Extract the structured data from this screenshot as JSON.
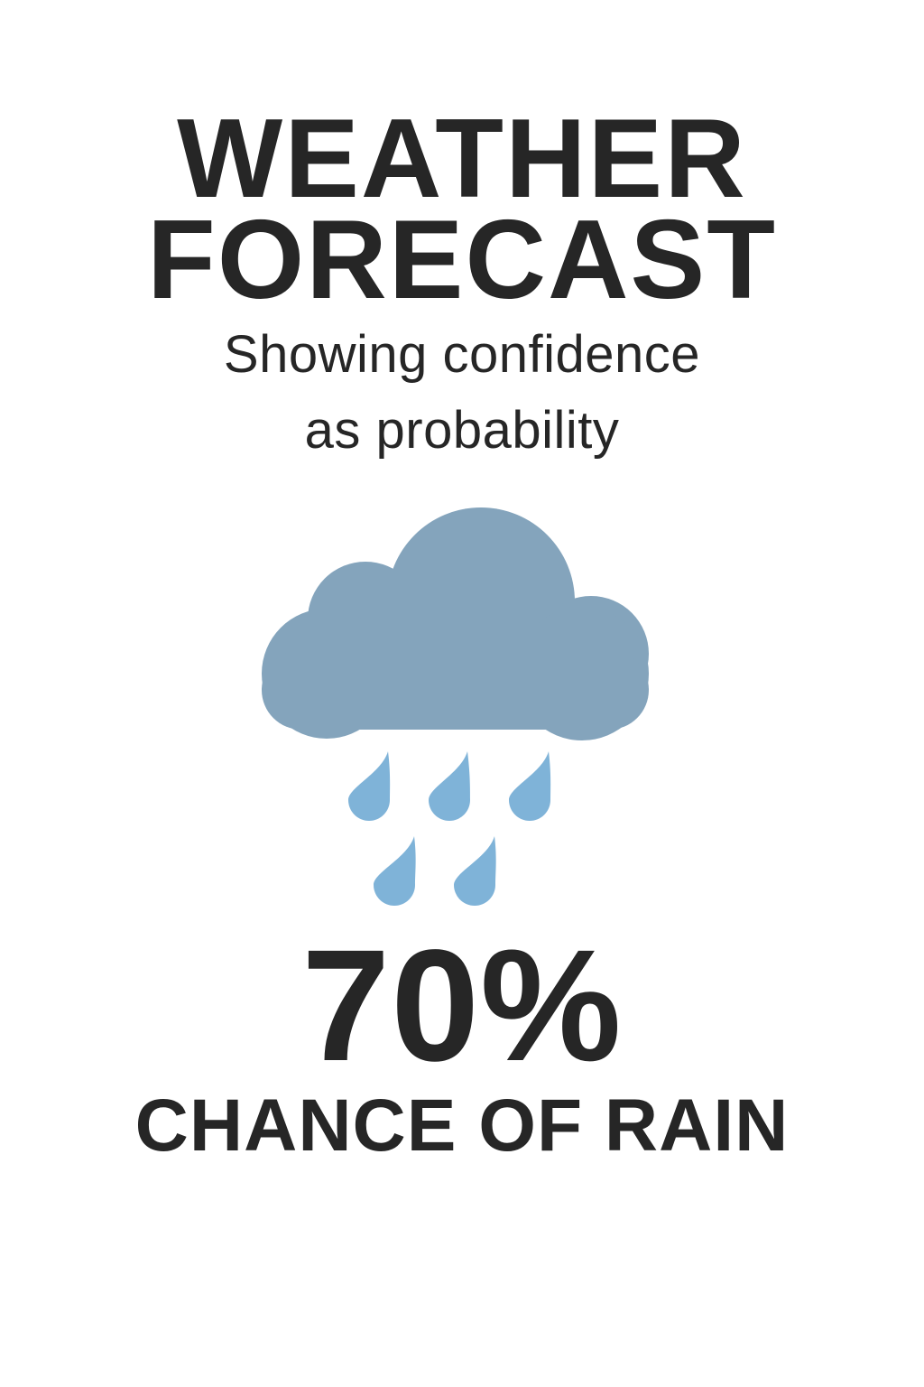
{
  "title": {
    "line1": "WEATHER",
    "line2": "FORECAST"
  },
  "subtitle": {
    "line1": "Showing confidence",
    "line2": "as probability"
  },
  "icon": {
    "name": "rain-cloud-icon",
    "cloud_color": "#84a4bc",
    "drop_color": "#7fb3d8",
    "drop_count": 5
  },
  "probability": {
    "value": 70,
    "label": "70%"
  },
  "caption": "CHANCE OF RAIN",
  "colors": {
    "text": "#262626",
    "background": "#ffffff"
  }
}
